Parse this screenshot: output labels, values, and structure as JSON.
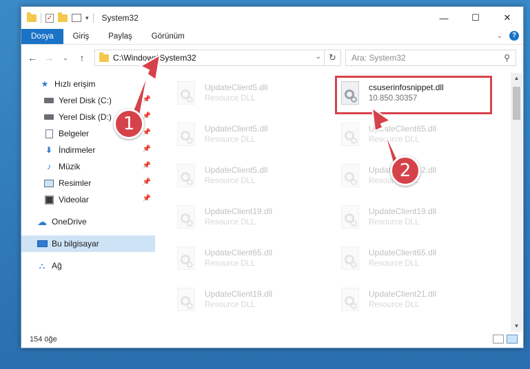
{
  "window": {
    "title": "System32",
    "controls": {
      "minimize": "—",
      "maximize": "☐",
      "close": "✕"
    }
  },
  "ribbon": {
    "tabs": [
      "Dosya",
      "Giriş",
      "Paylaş",
      "Görünüm"
    ]
  },
  "nav": {
    "address": "C:\\Windows\\System32",
    "search_placeholder": "Ara: System32"
  },
  "sidebar": {
    "items": [
      {
        "label": "Hızlı erişim",
        "icon": "star-icon",
        "pinned": false
      },
      {
        "label": "Yerel Disk (C:)",
        "icon": "drive-icon",
        "pinned": true
      },
      {
        "label": "Yerel Disk (D:)",
        "icon": "drive-icon",
        "pinned": true
      },
      {
        "label": "Belgeler",
        "icon": "documents-icon",
        "pinned": true
      },
      {
        "label": "İndirmeler",
        "icon": "download-icon",
        "pinned": true
      },
      {
        "label": "Müzik",
        "icon": "music-icon",
        "pinned": true
      },
      {
        "label": "Resimler",
        "icon": "pictures-icon",
        "pinned": true
      },
      {
        "label": "Videolar",
        "icon": "video-icon",
        "pinned": true
      },
      {
        "label": "OneDrive",
        "icon": "cloud-icon",
        "pinned": false
      },
      {
        "label": "Bu bilgisayar",
        "icon": "computer-icon",
        "pinned": false,
        "selected": true
      },
      {
        "label": "Ağ",
        "icon": "network-icon",
        "pinned": false
      }
    ]
  },
  "files": {
    "left_column": [
      {
        "name": "UpdateClient5.dll",
        "type": "Resource DLL"
      },
      {
        "name": "UpdateClient5.dll",
        "type": "Resource DLL"
      },
      {
        "name": "UpdateClient5.dll",
        "type": "Resource DLL"
      },
      {
        "name": "UpdateClient19.dll",
        "type": "Resource DLL"
      },
      {
        "name": "UpdateClient65.dll",
        "type": "Resource DLL"
      },
      {
        "name": "UpdateClient19.dll",
        "type": "Resource DLL"
      }
    ],
    "right_column": [
      {
        "name": "csuserinfosnippet.dll",
        "type": "10.850.30357",
        "highlighted": true
      },
      {
        "name": "UpdateClient65.dll",
        "type": "Resource DLL"
      },
      {
        "name": "UpdateClient42.dll",
        "type": "Resource DLL"
      },
      {
        "name": "UpdateClient19.dll",
        "type": "Resource DLL"
      },
      {
        "name": "UpdateClient65.dll",
        "type": "Resource DLL"
      },
      {
        "name": "UpdateClient21.dll",
        "type": "Resource DLL"
      }
    ]
  },
  "status": {
    "count": "154 öğe"
  },
  "annotations": {
    "step1": "1",
    "step2": "2",
    "color": "#d6424a"
  }
}
